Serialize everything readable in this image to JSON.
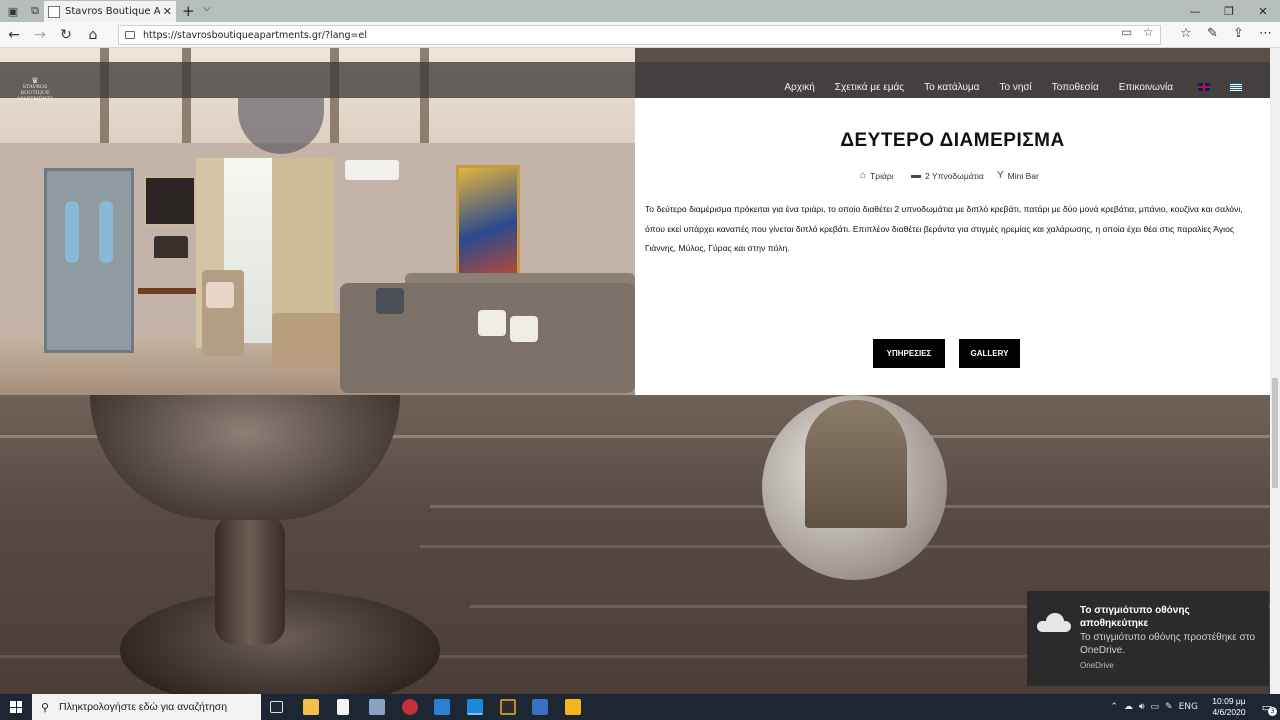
{
  "browser": {
    "tab_title": "Stavros Boutique Apartr",
    "url": "https://stavrosboutiqueapartments.gr/?lang=el",
    "close_glyph": "✕",
    "new_tab_glyph": "+"
  },
  "site": {
    "logo_line1": "STAVROS BOUTIQUE",
    "logo_line2": "APARTMENTS",
    "nav": [
      "Αρχική",
      "Σχετικά με εμάς",
      "Το κατάλυμα",
      "Το νησί",
      "Τοποθεσία",
      "Επικοινωνία"
    ]
  },
  "apartment": {
    "title": "ΔΕΥΤΕΡΟ ΔΙΑΜΕΡΙΣΜΑ",
    "amenities": [
      {
        "icon": "home-icon",
        "label": "Τριάρι"
      },
      {
        "icon": "bed-icon",
        "label": "2 Υπνοδωμάτια"
      },
      {
        "icon": "cocktail-icon",
        "label": "Mini Bar"
      }
    ],
    "description": "Το δεύτερο διαμέρισμα πρόκειται για ένα τριάρι, το οποίο διαθέτει 2 υπνοδωμάτια με διπλό κρεβάτι, πατάρι με δύο μονά κρεβάτια, μπάνιο, κουζίνα και σαλόνι, όπου εκεί υπάρχει καναπές που γίνεται διπλό κρεβάτι. Επιπλέον διαθέτει βεράντα για στιγμές ηρεμίας και χαλάρωσης, η οποία έχει θέα στις παραλίες Άγιος Γιάννης, Μύλος, Γύρας και στην πόλη.",
    "buttons": {
      "services": "ΥΠΗΡΕΣΙΕΣ",
      "gallery": "GALLERY"
    }
  },
  "toast": {
    "title": "Το στιγμιότυπο οθόνης αποθηκεύτηκε",
    "body": "Το στιγμιότυπο οθόνης προστέθηκε στο OneDrive.",
    "source": "OneDrive"
  },
  "taskbar": {
    "search_placeholder": "Πληκτρολογήστε εδώ για αναζήτηση",
    "language": "ENG",
    "time": "10:09 μμ",
    "date": "4/6/2020",
    "notification_count": "3"
  },
  "colors": {
    "header_overlay": "#3c3c3c",
    "button_bg": "#000000",
    "taskbar_bg": "#1c2733",
    "toast_bg": "#2b2b2b"
  }
}
